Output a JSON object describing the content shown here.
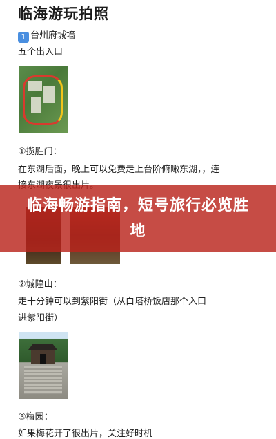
{
  "article": {
    "title": "临海游玩拍照",
    "items": [
      {
        "badge": "1",
        "heading": "台州府城墙",
        "lines": [
          "五个出入口"
        ]
      },
      {
        "heading": "①揽胜门：",
        "lines": [
          "在东湖后面，晚上可以免费走上台阶俯瞰东湖，，连",
          "接东湖夜景很出片。"
        ]
      },
      {
        "heading": "②城隍山：",
        "lines": [
          "走十分钟可以到紫阳街（从白塔桥饭店那个入口",
          "进紫阳街）"
        ]
      },
      {
        "heading": "③梅园：",
        "lines": [
          "如果梅花开了很出片，关注好时机"
        ]
      }
    ]
  },
  "banner": {
    "text": "临海畅游指南，短号旅行必览胜地",
    "color": "#ba241c"
  }
}
